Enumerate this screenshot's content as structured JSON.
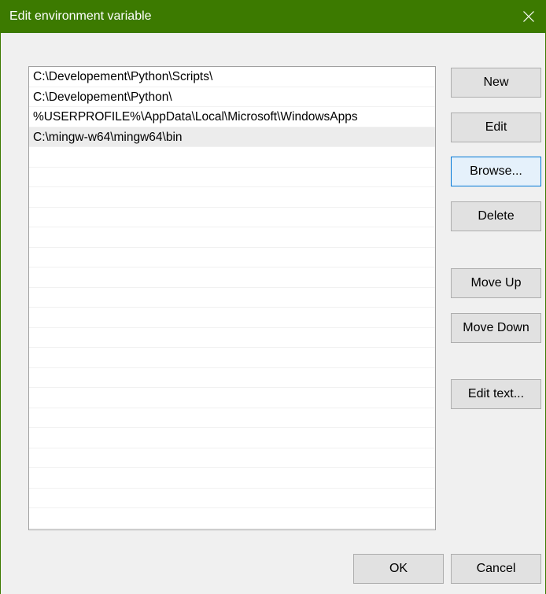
{
  "window": {
    "title": "Edit environment variable",
    "close_icon": "close-icon",
    "titlebar_color": "#3c7a00"
  },
  "path_list": {
    "items": [
      {
        "text": "C:\\Developement\\Python\\Scripts\\",
        "selected": false
      },
      {
        "text": "C:\\Developement\\Python\\",
        "selected": false
      },
      {
        "text": "%USERPROFILE%\\AppData\\Local\\Microsoft\\WindowsApps",
        "selected": false
      },
      {
        "text": "C:\\mingw-w64\\mingw64\\bin",
        "selected": true
      }
    ]
  },
  "buttons": {
    "new": "New",
    "edit": "Edit",
    "browse": "Browse...",
    "delete": "Delete",
    "move_up": "Move Up",
    "move_down": "Move Down",
    "edit_text": "Edit text...",
    "ok": "OK",
    "cancel": "Cancel"
  },
  "focus": "browse"
}
